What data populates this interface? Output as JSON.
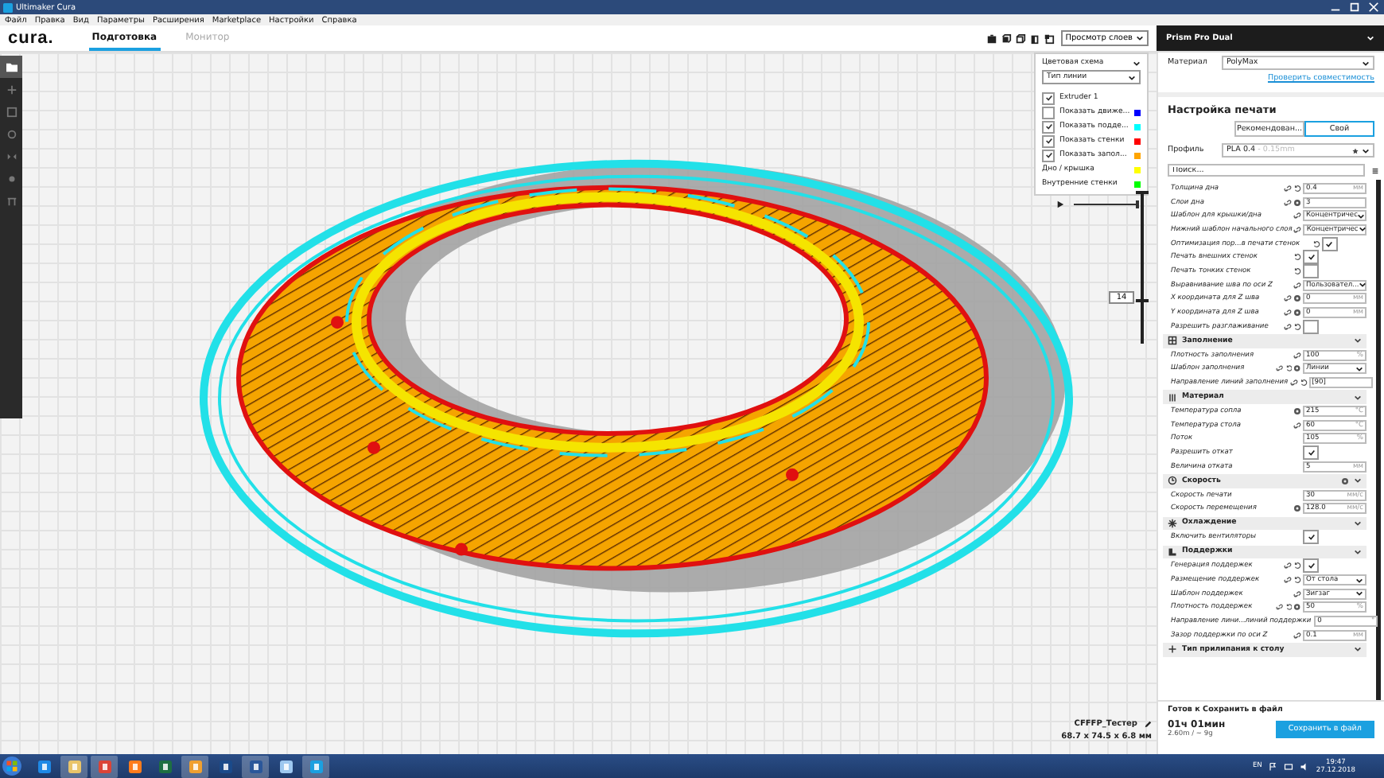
{
  "window": {
    "title": "Ultimaker Cura"
  },
  "menu": [
    "Файл",
    "Правка",
    "Вид",
    "Параметры",
    "Расширения",
    "Marketplace",
    "Настройки",
    "Справка"
  ],
  "header": {
    "logo": "cura.",
    "tabs": [
      {
        "label": "Подготовка",
        "selected": true
      },
      {
        "label": "Монитор",
        "selected": false
      }
    ],
    "view_mode": "Просмотр слоев",
    "printer": "Prism Pro Dual"
  },
  "toolbar": [
    {
      "kind": "open",
      "selected": true
    },
    {
      "kind": "move",
      "selected": false
    },
    {
      "kind": "scale",
      "selected": false
    },
    {
      "kind": "rotate",
      "selected": false
    },
    {
      "kind": "mirror",
      "selected": false
    },
    {
      "kind": "permodel",
      "selected": false
    },
    {
      "kind": "support",
      "selected": false
    }
  ],
  "legend": {
    "title": "Цветовая схема",
    "scheme": "Тип линии",
    "items": [
      {
        "kind": "checkbox",
        "label": "Extruder 1",
        "checked": true
      },
      {
        "kind": "checkbox",
        "label": "Показать движе...",
        "checked": false,
        "color": "#0000ff"
      },
      {
        "kind": "checkbox",
        "label": "Показать подде...",
        "checked": true,
        "color": "#00ffff"
      },
      {
        "kind": "checkbox",
        "label": "Показать стенки",
        "checked": true,
        "color": "#ff0000"
      },
      {
        "kind": "checkbox",
        "label": "Показать запол...",
        "checked": true,
        "color": "#ffa500"
      },
      {
        "kind": "swatch",
        "label": "Дно / крышка",
        "color": "#ffff00"
      },
      {
        "kind": "swatch",
        "label": "Внутренние стенки",
        "color": "#00ff00"
      }
    ]
  },
  "play_slider": {
    "level": 1
  },
  "layer_slider": {
    "layer": "14",
    "level": 0.3
  },
  "object": {
    "name": "CFFFP_Тестер",
    "dimensions": "68.7 x 74.5 x 6.8 мм"
  },
  "panel": {
    "material_label": "Материал",
    "material": "PolyMax",
    "compat_link": "Проверить совместимость",
    "settings_title": "Настройка печати",
    "modes": [
      {
        "label": "Рекомендован...",
        "selected": false
      },
      {
        "label": "Свой",
        "selected": true
      }
    ],
    "profile_label": "Профиль",
    "profile": "PLA 0.4",
    "profile_note": "- 0.15mm",
    "search_placeholder": "Поиск..."
  },
  "settings": [
    {
      "kind": "input",
      "label": "Толщина дна",
      "linked": true,
      "reset": true,
      "gear": false,
      "value": "0.4",
      "unit": "мм"
    },
    {
      "kind": "input",
      "label": "Слои дна",
      "linked": true,
      "reset": false,
      "gear": true,
      "value": "3"
    },
    {
      "kind": "select",
      "label": "Шаблон для крышки/дна",
      "linked": true,
      "reset": false,
      "gear": false,
      "value": "Концентричес"
    },
    {
      "kind": "select",
      "label": "Нижний шаблон начального слоя",
      "linked": true,
      "reset": false,
      "gear": false,
      "value": "Концентричес"
    },
    {
      "kind": "checkbox",
      "label": "Оптимизация пор...в печати стенок",
      "linked": false,
      "reset": true,
      "gear": false,
      "checked": true
    },
    {
      "kind": "checkbox",
      "label": "Печать внешних стенок",
      "linked": false,
      "reset": true,
      "gear": false,
      "checked": true
    },
    {
      "kind": "checkbox",
      "label": "Печать тонких стенок",
      "linked": false,
      "reset": true,
      "gear": false,
      "checked": false
    },
    {
      "kind": "select",
      "label": "Выравнивание шва по оси Z",
      "linked": true,
      "reset": false,
      "gear": false,
      "value": "Пользовател..."
    },
    {
      "kind": "input",
      "label": "X координата для Z шва",
      "linked": true,
      "reset": false,
      "gear": true,
      "value": "0",
      "unit": "мм"
    },
    {
      "kind": "input",
      "label": "Y координата для Z шва",
      "linked": true,
      "reset": false,
      "gear": true,
      "value": "0",
      "unit": "мм"
    },
    {
      "kind": "checkbox",
      "label": "Разрешить разглаживание",
      "linked": true,
      "reset": true,
      "gear": false,
      "checked": false
    },
    {
      "kind": "section",
      "label": "Заполнение",
      "gear": false
    },
    {
      "kind": "input",
      "label": "Плотность заполнения",
      "linked": true,
      "reset": false,
      "gear": false,
      "value": "100",
      "unit": "%"
    },
    {
      "kind": "select",
      "label": "Шаблон заполнения",
      "linked": true,
      "reset": true,
      "gear": true,
      "value": "Линии"
    },
    {
      "kind": "input",
      "label": "Направление линий заполнения",
      "linked": true,
      "reset": true,
      "gear": false,
      "value": "[90]"
    },
    {
      "kind": "section",
      "label": "Материал",
      "gear": false
    },
    {
      "kind": "input",
      "label": "Температура сопла",
      "linked": false,
      "reset": false,
      "gear": true,
      "value": "215",
      "unit": "°C"
    },
    {
      "kind": "input",
      "label": "Температура стола",
      "linked": true,
      "reset": false,
      "gear": false,
      "value": "60",
      "unit": "°C"
    },
    {
      "kind": "input",
      "label": "Поток",
      "linked": false,
      "reset": false,
      "gear": false,
      "value": "105",
      "unit": "%"
    },
    {
      "kind": "checkbox",
      "label": "Разрешить откат",
      "linked": false,
      "reset": false,
      "gear": false,
      "checked": true
    },
    {
      "kind": "input",
      "label": "Величина отката",
      "linked": false,
      "reset": false,
      "gear": false,
      "value": "5",
      "unit": "мм"
    },
    {
      "kind": "section",
      "label": "Скорость",
      "gear": true
    },
    {
      "kind": "input",
      "label": "Скорость печати",
      "linked": false,
      "reset": false,
      "gear": false,
      "value": "30",
      "unit": "мм/с"
    },
    {
      "kind": "input",
      "label": "Скорость перемещения",
      "linked": false,
      "reset": false,
      "gear": true,
      "value": "128.0",
      "unit": "мм/с"
    },
    {
      "kind": "section",
      "label": "Охлаждение",
      "gear": false
    },
    {
      "kind": "checkbox",
      "label": "Включить вентиляторы",
      "linked": false,
      "reset": false,
      "gear": false,
      "checked": true
    },
    {
      "kind": "section",
      "label": "Поддержки",
      "gear": false
    },
    {
      "kind": "checkbox",
      "label": "Генерация поддержек",
      "linked": true,
      "reset": true,
      "gear": false,
      "checked": true
    },
    {
      "kind": "select",
      "label": "Размещение поддержек",
      "linked": true,
      "reset": true,
      "gear": false,
      "value": "От стола"
    },
    {
      "kind": "select",
      "label": "Шаблон поддержек",
      "linked": true,
      "reset": false,
      "gear": false,
      "value": "Зигзаг"
    },
    {
      "kind": "input",
      "label": "Плотность поддержек",
      "linked": true,
      "reset": true,
      "gear": true,
      "value": "50",
      "unit": "%"
    },
    {
      "kind": "input",
      "label": "Направление лини...линий поддержки",
      "linked": false,
      "reset": false,
      "gear": false,
      "value": "0",
      "unit": "°"
    },
    {
      "kind": "input",
      "label": "Зазор поддержки по оси Z",
      "linked": true,
      "reset": false,
      "gear": false,
      "value": "0.1",
      "unit": "мм"
    },
    {
      "kind": "section",
      "label": "Тип прилипания к столу",
      "gear": false
    }
  ],
  "status": {
    "title": "Готов к Сохранить в файл",
    "time": "01ч 01мин",
    "material": "2.60m / ~ 9g",
    "button": "Сохранить в файл"
  },
  "taskbar": {
    "apps": [
      {
        "kind": "ie",
        "open": false
      },
      {
        "kind": "folder",
        "open": true
      },
      {
        "kind": "chrome",
        "open": true
      },
      {
        "kind": "firefox",
        "open": false
      },
      {
        "kind": "excel",
        "open": false
      },
      {
        "kind": "orange",
        "open": true
      },
      {
        "kind": "blueletter",
        "open": false
      },
      {
        "kind": "word",
        "open": true
      },
      {
        "kind": "notepad",
        "open": false
      },
      {
        "kind": "cura",
        "open": true
      }
    ],
    "lang": "EN",
    "time": "19:47",
    "date": "27.12.2018"
  }
}
